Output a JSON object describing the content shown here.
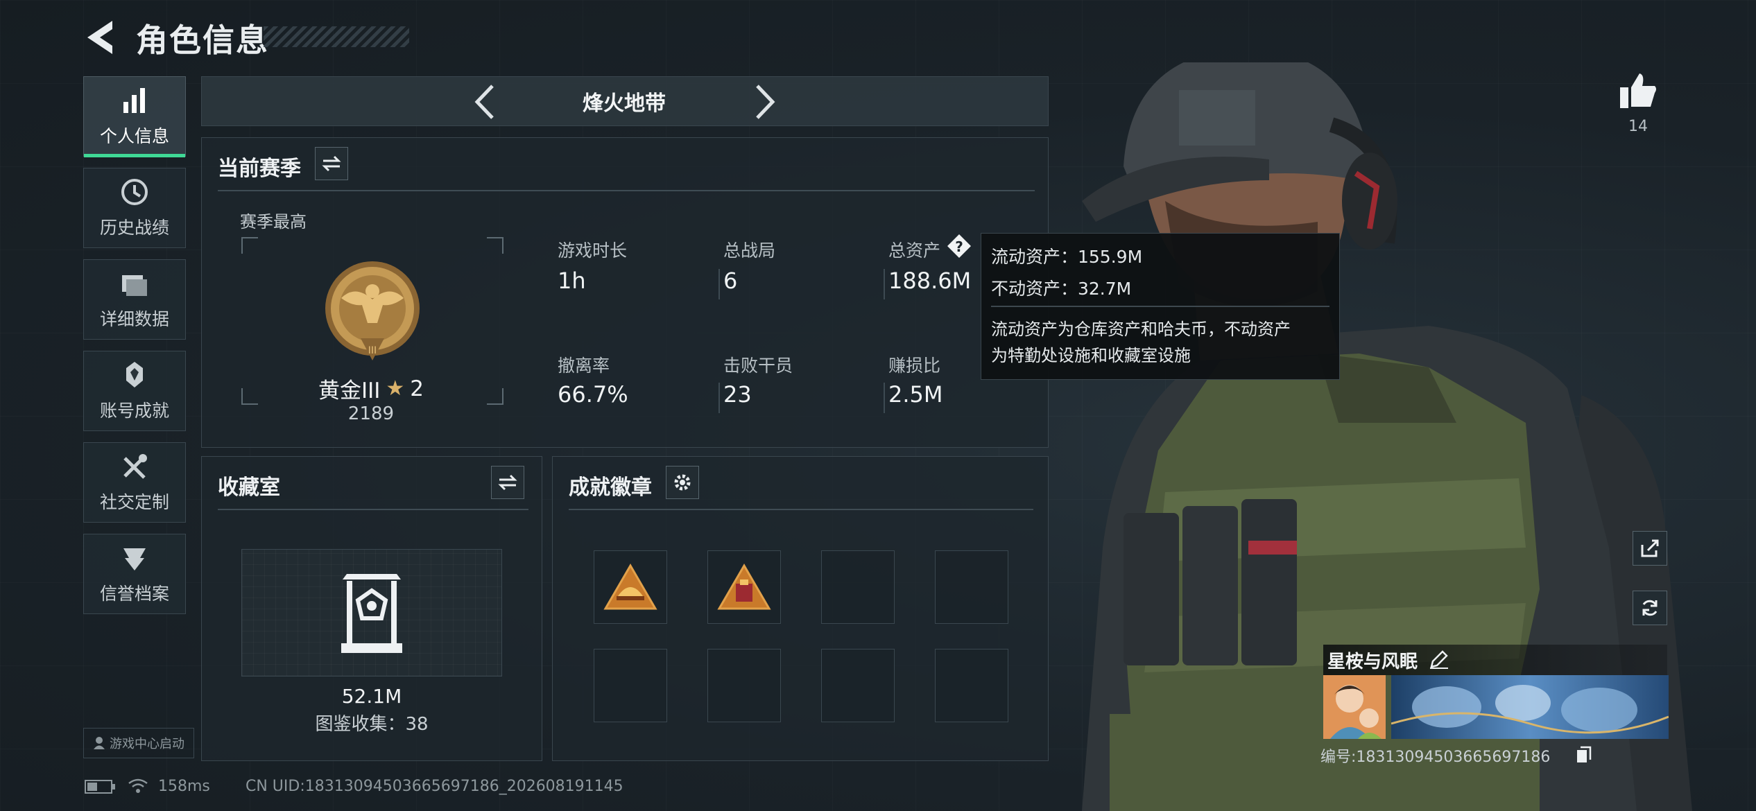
{
  "header": {
    "title": "角色信息"
  },
  "nav": {
    "items": [
      {
        "label": "个人信息",
        "icon": "bar-chart-icon",
        "active": true
      },
      {
        "label": "历史战绩",
        "icon": "clock-icon"
      },
      {
        "label": "详细数据",
        "icon": "folder-icon"
      },
      {
        "label": "账号成就",
        "icon": "achievement-icon"
      },
      {
        "label": "社交定制",
        "icon": "tools-icon"
      },
      {
        "label": "信誉档案",
        "icon": "credit-icon"
      }
    ],
    "launch_label": "游戏中心启动"
  },
  "mode": {
    "label": "烽火地带"
  },
  "season": {
    "title": "当前赛季",
    "best_label": "赛季最高",
    "rank_name": "黄金III",
    "rank_stars": "2",
    "rank_points": "2189",
    "stats": [
      {
        "label": "游戏时长",
        "value": "1h"
      },
      {
        "label": "总战局",
        "value": "6"
      },
      {
        "label": "总资产",
        "value": "188.6M"
      },
      {
        "label": "撤离率",
        "value": "66.7%"
      },
      {
        "label": "击败干员",
        "value": "23"
      },
      {
        "label": "赚损比",
        "value": "2.5M"
      }
    ]
  },
  "tooltip": {
    "line1": "流动资产：155.9M",
    "line2": "不动资产：32.7M",
    "desc1": "流动资产为仓库资产和哈夫币，不动资产",
    "desc2": "为特勤处设施和收藏室设施"
  },
  "collection": {
    "title": "收藏室",
    "value": "52.1M",
    "count_label": "图鉴收集：38"
  },
  "badges": {
    "title": "成就徽章"
  },
  "profile": {
    "likes": "14",
    "name": "星桉与风眠",
    "id_text": "编号:18313094503665697186"
  },
  "footer": {
    "ping": "158ms",
    "uid": "CN UID:18313094503665697186_202608191145"
  },
  "colors": {
    "accent": "#3fd996",
    "background": "#1b2329",
    "medal_gold": "#c49a55"
  }
}
